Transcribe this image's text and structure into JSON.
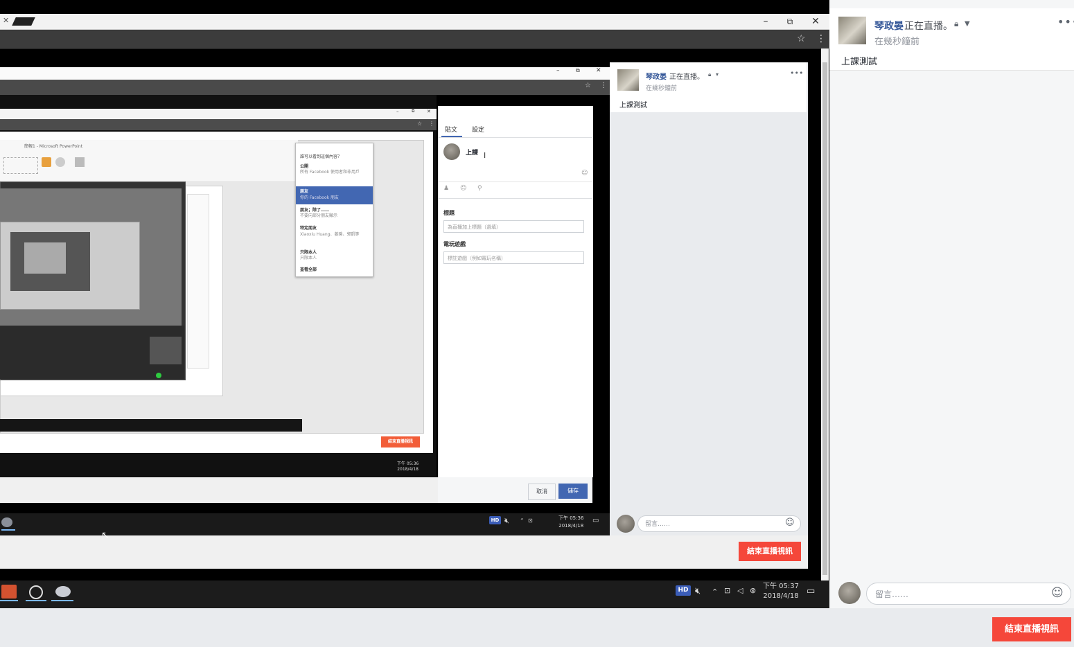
{
  "video": {
    "window_buttons": {
      "minimize": "–",
      "maximize": "⧉",
      "close": "✕"
    },
    "tab_close": "✕",
    "star_icon": "☆",
    "menu_icon": "⋮",
    "level2": {
      "broadcaster_name": "琴政晏",
      "live_status": "正在直播。",
      "time": "在幾秒鐘前",
      "post_text": "上課測試",
      "comment_placeholder": "留言……",
      "end_button": "結束直播視訊",
      "clock_time": "下午 05:36",
      "clock_date": "2018/4/18",
      "hd_label": "HD",
      "composer": {
        "tab_post": "貼文",
        "tab_settings": "設定",
        "typed_text": "上課",
        "title_label": "標題",
        "title_placeholder": "為直播加上標題（選填）",
        "game_label": "電玩遊戲",
        "game_placeholder": "標註遊戲（例如電玩名稱）",
        "cancel_button": "取消",
        "save_button": "儲存"
      }
    },
    "level3": {
      "ppt_title": "簡報1 - Microsoft PowerPoint",
      "privacy_menu": {
        "header": "誰可以看到這個內容？",
        "items": [
          {
            "label": "公開",
            "desc": "所有 Facebook 使用者和非用戶"
          },
          {
            "label": "朋友",
            "desc": "你的 Facebook 朋友"
          },
          {
            "label": "朋友；除了……",
            "desc": "不要向部分朋友顯示"
          },
          {
            "label": "特定朋友",
            "desc": "Xiaoxiu Huang、姜瑜、郭凱等"
          },
          {
            "label": "只限本人",
            "desc": "只限本人"
          },
          {
            "label": "查看全部",
            "desc": ""
          }
        ]
      },
      "end_button": "結束直播視訊",
      "clock_time": "下午 05:36",
      "clock_date": "2018/4/18"
    },
    "taskbar": {
      "hd_label": "HD",
      "clock_time": "下午 05:37",
      "clock_date": "2018/4/18"
    }
  },
  "live_panel": {
    "broadcaster_name": "琴政晏",
    "live_status": "正在直播。",
    "time": "在幾秒鐘前",
    "more_icon": "•••",
    "post_text": "上課測試",
    "comment_placeholder": "留言……",
    "end_button": "結束直播視訊"
  },
  "colors": {
    "facebook_blue": "#4267b2",
    "name_blue": "#365899",
    "end_red": "#f5473a"
  }
}
